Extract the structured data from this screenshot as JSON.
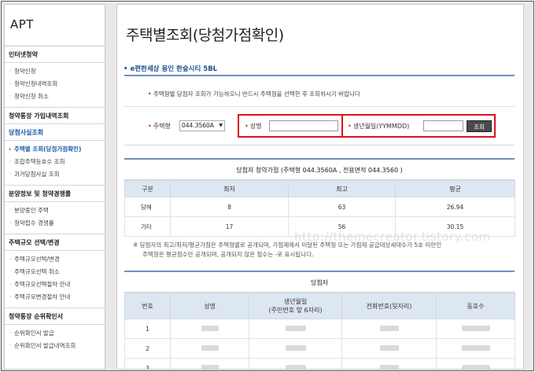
{
  "sidebar": {
    "title": "APT",
    "sections": [
      {
        "label": "인터넷청약",
        "selected": false,
        "items": [
          {
            "label": "청약신청",
            "selected": false
          },
          {
            "label": "청약신청내역조회",
            "selected": false
          },
          {
            "label": "청약신청 취소",
            "selected": false
          }
        ]
      },
      {
        "label": "청약통장 가입내역조회",
        "selected": false,
        "items": []
      },
      {
        "label": "당첨사실조회",
        "selected": true,
        "items": [
          {
            "label": "주택별 조회(당첨가점확인)",
            "selected": true
          },
          {
            "label": "조합주택등호수 조회",
            "selected": false
          },
          {
            "label": "과거당첨사실 조회",
            "selected": false
          }
        ]
      },
      {
        "label": "분양정보 및 청약경쟁률",
        "selected": false,
        "items": [
          {
            "label": "분양중인 주택",
            "selected": false
          },
          {
            "label": "청약접수 경쟁률",
            "selected": false
          }
        ]
      },
      {
        "label": "주택규모 선택/변경",
        "selected": false,
        "items": [
          {
            "label": "주택규모선택/변경",
            "selected": false
          },
          {
            "label": "주택규모선택 취소",
            "selected": false
          },
          {
            "label": "주택규모선택절차 안내",
            "selected": false
          },
          {
            "label": "주택규모변경절차 안내",
            "selected": false
          }
        ]
      },
      {
        "label": "청약통장 순위확인서",
        "selected": false,
        "items": [
          {
            "label": "순위확인서 발급",
            "selected": false
          },
          {
            "label": "순위확인서 발급내역조회",
            "selected": false
          }
        ]
      }
    ]
  },
  "main": {
    "title": "주택별조회(당첨가점확인)",
    "apt_name": "e편한세상 용인 한숲시티 5BL",
    "notice": "주택형별 당첨자 조회가 가능하오니 반드시 주택형을 선택한 후 조회하시기 바랍니다",
    "form": {
      "house_type_label": "주택형",
      "house_type_value": "044.3560A",
      "name_label": "성명",
      "name_value": "",
      "birth_label": "생년월일(YYMMDD)",
      "birth_value": "",
      "search_button": "조회"
    },
    "score_table": {
      "caption": "당첨자 청약가점 (주택형 044.3560A , 전용면적 044.3560 )",
      "headers": [
        "구분",
        "최저",
        "최고",
        "평균"
      ],
      "rows": [
        [
          "당해",
          "8",
          "63",
          "26.94"
        ],
        [
          "기타",
          "17",
          "56",
          "30.15"
        ]
      ]
    },
    "note_lines": [
      "※ 당첨자의 최고/최저/평균가점은 주택형별로 공개되며, 가점제에서 미달된 주택형 또는 가점제 공급대상세대수가 5호 미만인",
      "주택형은 평균점수만 공개되며, 공개되지 않은 점수는 -로 표시됩니다."
    ],
    "winner_table": {
      "caption": "당첨자",
      "headers": [
        "번호",
        "성명",
        "생년월일\n(주민번호 앞 6자리)",
        "전화번호(뒷자리)",
        "동호수"
      ],
      "rows": [
        [
          "1"
        ],
        [
          "2"
        ],
        [
          "3"
        ]
      ]
    }
  },
  "watermark": "http://themecreator.tistory.com",
  "colors": {
    "accent": "#1e5aa8",
    "highlight": "#e0101a",
    "header_bg": "#dde7f2"
  }
}
